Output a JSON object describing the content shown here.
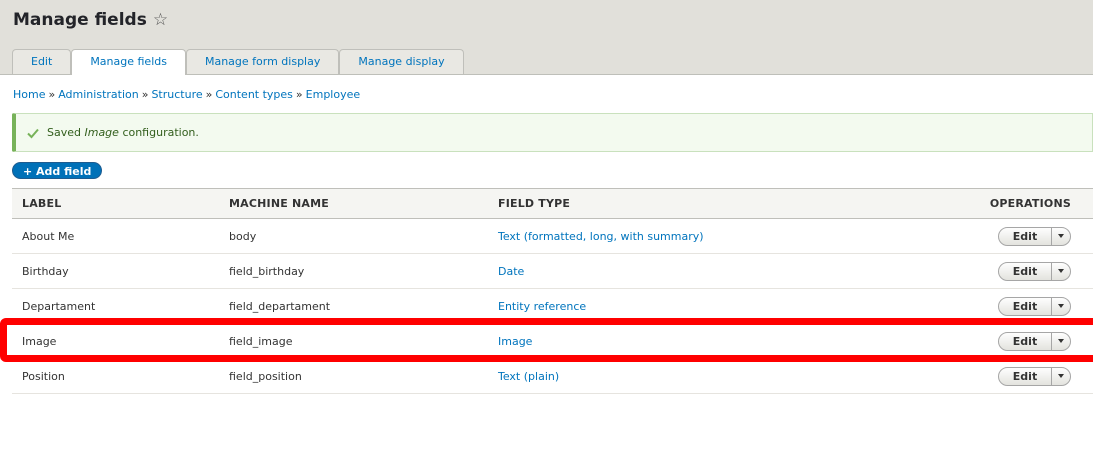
{
  "page": {
    "title": "Manage fields",
    "favorite_icon": "star-outline-icon"
  },
  "tabs": [
    {
      "label": "Edit",
      "active": false
    },
    {
      "label": "Manage fields",
      "active": true
    },
    {
      "label": "Manage form display",
      "active": false
    },
    {
      "label": "Manage display",
      "active": false
    }
  ],
  "breadcrumb": {
    "items": [
      "Home",
      "Administration",
      "Structure",
      "Content types",
      "Employee"
    ],
    "separator": "»"
  },
  "message": {
    "icon": "check-icon",
    "prefix": "Saved",
    "field": "Image",
    "suffix": "configuration.",
    "status": "success"
  },
  "add_field": {
    "label": "+ Add field"
  },
  "table": {
    "headers": {
      "label": "LABEL",
      "machine_name": "MACHINE NAME",
      "field_type": "FIELD TYPE",
      "operations": "OPERATIONS"
    },
    "rows": [
      {
        "label": "About Me",
        "machine_name": "body",
        "field_type": "Text (formatted, long, with summary)",
        "op": "Edit"
      },
      {
        "label": "Birthday",
        "machine_name": "field_birthday",
        "field_type": "Date",
        "op": "Edit"
      },
      {
        "label": "Departament",
        "machine_name": "field_departament",
        "field_type": "Entity reference",
        "op": "Edit"
      },
      {
        "label": "Image",
        "machine_name": "field_image",
        "field_type": "Image",
        "op": "Edit",
        "highlighted": true
      },
      {
        "label": "Position",
        "machine_name": "field_position",
        "field_type": "Text (plain)",
        "op": "Edit"
      }
    ]
  },
  "colors": {
    "link": "#0074bd",
    "header_bg": "#e1e0da",
    "success_bg": "#f3faef",
    "success_border": "#77b259",
    "primary_button": "#0071b8",
    "highlight": "#ff0000"
  }
}
